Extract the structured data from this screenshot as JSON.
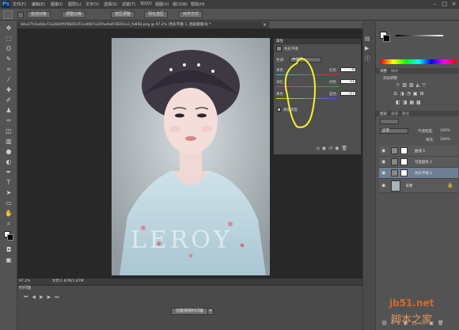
{
  "app": {
    "logo": "Ps"
  },
  "menu": {
    "items": [
      "文件(F)",
      "编辑(E)",
      "图像(I)",
      "图层(L)",
      "文字(Y)",
      "选择(S)",
      "滤镜(T)",
      "3D(D)",
      "视图(V)",
      "窗口(W)",
      "帮助(H)"
    ]
  },
  "options": {
    "buttons": [
      "自动对象",
      "调整边缘",
      "选区调整",
      "羽化选区",
      "对齐方式"
    ]
  },
  "document": {
    "tab_title": "84e37%5e64e72a2849f5f0845d72cafd07a35%efe4f-DD51e3_fe858.png @ 97.2% (色彩平衡 1, 图层蒙版/8) *",
    "zoom": "97.2%",
    "doc_info": "文档:1.87M/1.87M"
  },
  "photo": {
    "overlay_text": "LEROY"
  },
  "properties": {
    "title": "属性",
    "adjust_name": "色彩平衡",
    "tone_label": "色调:",
    "tone_value": "中间调",
    "rows": [
      {
        "left": "青色",
        "right": "红色",
        "value": "-6"
      },
      {
        "left": "洋红",
        "right": "绿色",
        "value": "+1"
      },
      {
        "left": "黄色",
        "right": "蓝色",
        "value": "-17"
      }
    ],
    "preserve_luminosity": "保留明度"
  },
  "timeline": {
    "title": "时间轴",
    "create_button": "创建视频时间轴"
  },
  "right": {
    "adjust_tabs": [
      "调整",
      "样式"
    ],
    "add_adjustment": "添加调整",
    "layer_tabs": [
      "图层",
      "通道",
      "路径"
    ],
    "blend_mode": "正常",
    "opacity_label": "不透明度:",
    "opacity_value": "100%",
    "fill_label": "填充:",
    "fill_value": "100%",
    "layers": [
      {
        "name": "曲线 1"
      },
      {
        "name": "可选颜色 1"
      },
      {
        "name": "色彩平衡 1"
      },
      {
        "name": "背景"
      }
    ]
  },
  "watermark": {
    "line1": "jb51.net",
    "line2": "脚本之家"
  },
  "colors": {
    "annotation": "#f5f22a",
    "accent": "#31a8ff"
  }
}
